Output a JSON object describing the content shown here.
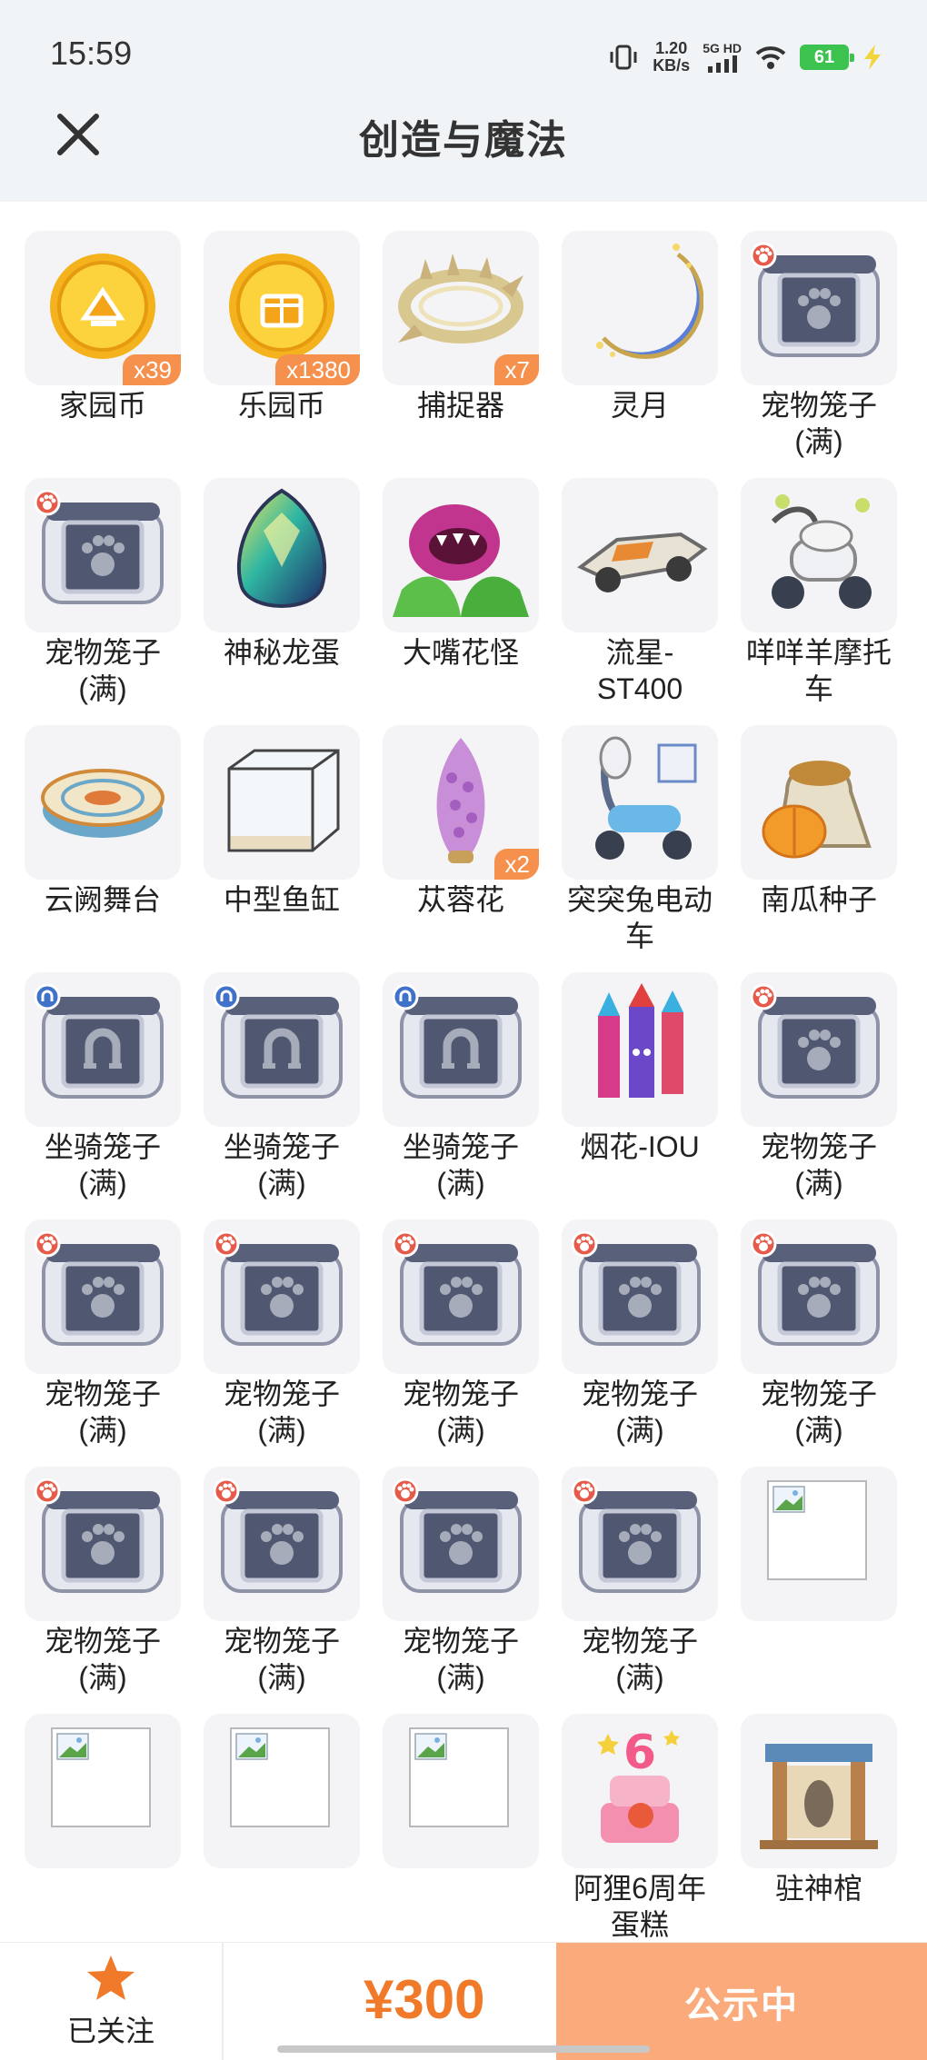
{
  "status_bar": {
    "time": "15:59",
    "net_speed_value": "1.20",
    "net_speed_unit": "KB/s",
    "signal_label": "5G HD",
    "battery": "61"
  },
  "nav": {
    "title": "创造与魔法"
  },
  "items": [
    {
      "name": "家园币",
      "qty": "x39",
      "icon": "gold-coin-home-icon"
    },
    {
      "name": "乐园币",
      "qty": "x1380",
      "icon": "gold-coin-park-icon"
    },
    {
      "name": "捕捉器",
      "qty": "x7",
      "icon": "catcher-icon"
    },
    {
      "name": "灵月",
      "qty": "",
      "icon": "crescent-moon-icon"
    },
    {
      "name": "宠物笼子\n(满)",
      "qty": "",
      "icon": "pet-cage-icon"
    },
    {
      "name": "宠物笼子\n(满)",
      "qty": "",
      "icon": "pet-cage-icon"
    },
    {
      "name": "神秘龙蛋",
      "qty": "",
      "icon": "dragon-egg-icon"
    },
    {
      "name": "大嘴花怪",
      "qty": "",
      "icon": "piranha-plant-icon"
    },
    {
      "name": "流星-\nST400",
      "qty": "",
      "icon": "meteor-vehicle-icon"
    },
    {
      "name": "咩咩羊摩托\n车",
      "qty": "",
      "icon": "sheep-motorbike-icon"
    },
    {
      "name": "云阙舞台",
      "qty": "",
      "icon": "dance-stage-icon"
    },
    {
      "name": "中型鱼缸",
      "qty": "",
      "icon": "fish-tank-icon"
    },
    {
      "name": "苁蓉花",
      "qty": "x2",
      "icon": "cistanche-flower-icon"
    },
    {
      "name": "突突兔电动\n车",
      "qty": "",
      "icon": "rabbit-scooter-icon"
    },
    {
      "name": "南瓜种子",
      "qty": "",
      "icon": "pumpkin-seed-icon"
    },
    {
      "name": "坐骑笼子\n(满)",
      "qty": "",
      "icon": "mount-cage-icon"
    },
    {
      "name": "坐骑笼子\n(满)",
      "qty": "",
      "icon": "mount-cage-icon"
    },
    {
      "name": "坐骑笼子\n(满)",
      "qty": "",
      "icon": "mount-cage-icon"
    },
    {
      "name": "烟花-IOU",
      "qty": "",
      "icon": "fireworks-icon"
    },
    {
      "name": "宠物笼子\n(满)",
      "qty": "",
      "icon": "pet-cage-icon"
    },
    {
      "name": "宠物笼子\n(满)",
      "qty": "",
      "icon": "pet-cage-icon"
    },
    {
      "name": "宠物笼子\n(满)",
      "qty": "",
      "icon": "pet-cage-icon"
    },
    {
      "name": "宠物笼子\n(满)",
      "qty": "",
      "icon": "pet-cage-icon"
    },
    {
      "name": "宠物笼子\n(满)",
      "qty": "",
      "icon": "pet-cage-icon"
    },
    {
      "name": "宠物笼子\n(满)",
      "qty": "",
      "icon": "pet-cage-icon"
    },
    {
      "name": "宠物笼子\n(满)",
      "qty": "",
      "icon": "pet-cage-icon"
    },
    {
      "name": "宠物笼子\n(满)",
      "qty": "",
      "icon": "pet-cage-icon"
    },
    {
      "name": "宠物笼子\n(满)",
      "qty": "",
      "icon": "pet-cage-icon"
    },
    {
      "name": "宠物笼子\n(满)",
      "qty": "",
      "icon": "pet-cage-icon"
    },
    {
      "name": "",
      "qty": "",
      "icon": "broken-image-icon"
    },
    {
      "name": "",
      "qty": "",
      "icon": "broken-image-icon"
    },
    {
      "name": "",
      "qty": "",
      "icon": "broken-image-icon"
    },
    {
      "name": "",
      "qty": "",
      "icon": "broken-image-icon"
    },
    {
      "name": "阿狸6周年\n蛋糕",
      "qty": "",
      "icon": "anniversary-cake-icon"
    },
    {
      "name": "驻神棺",
      "qty": "",
      "icon": "shrine-gate-icon"
    }
  ],
  "bottom": {
    "follow_label": "已关注",
    "price": "¥300",
    "status_button": "公示中"
  },
  "colors": {
    "accent": "#f07a2a",
    "badge": "#f5914c",
    "button": "#fbaa7c"
  }
}
